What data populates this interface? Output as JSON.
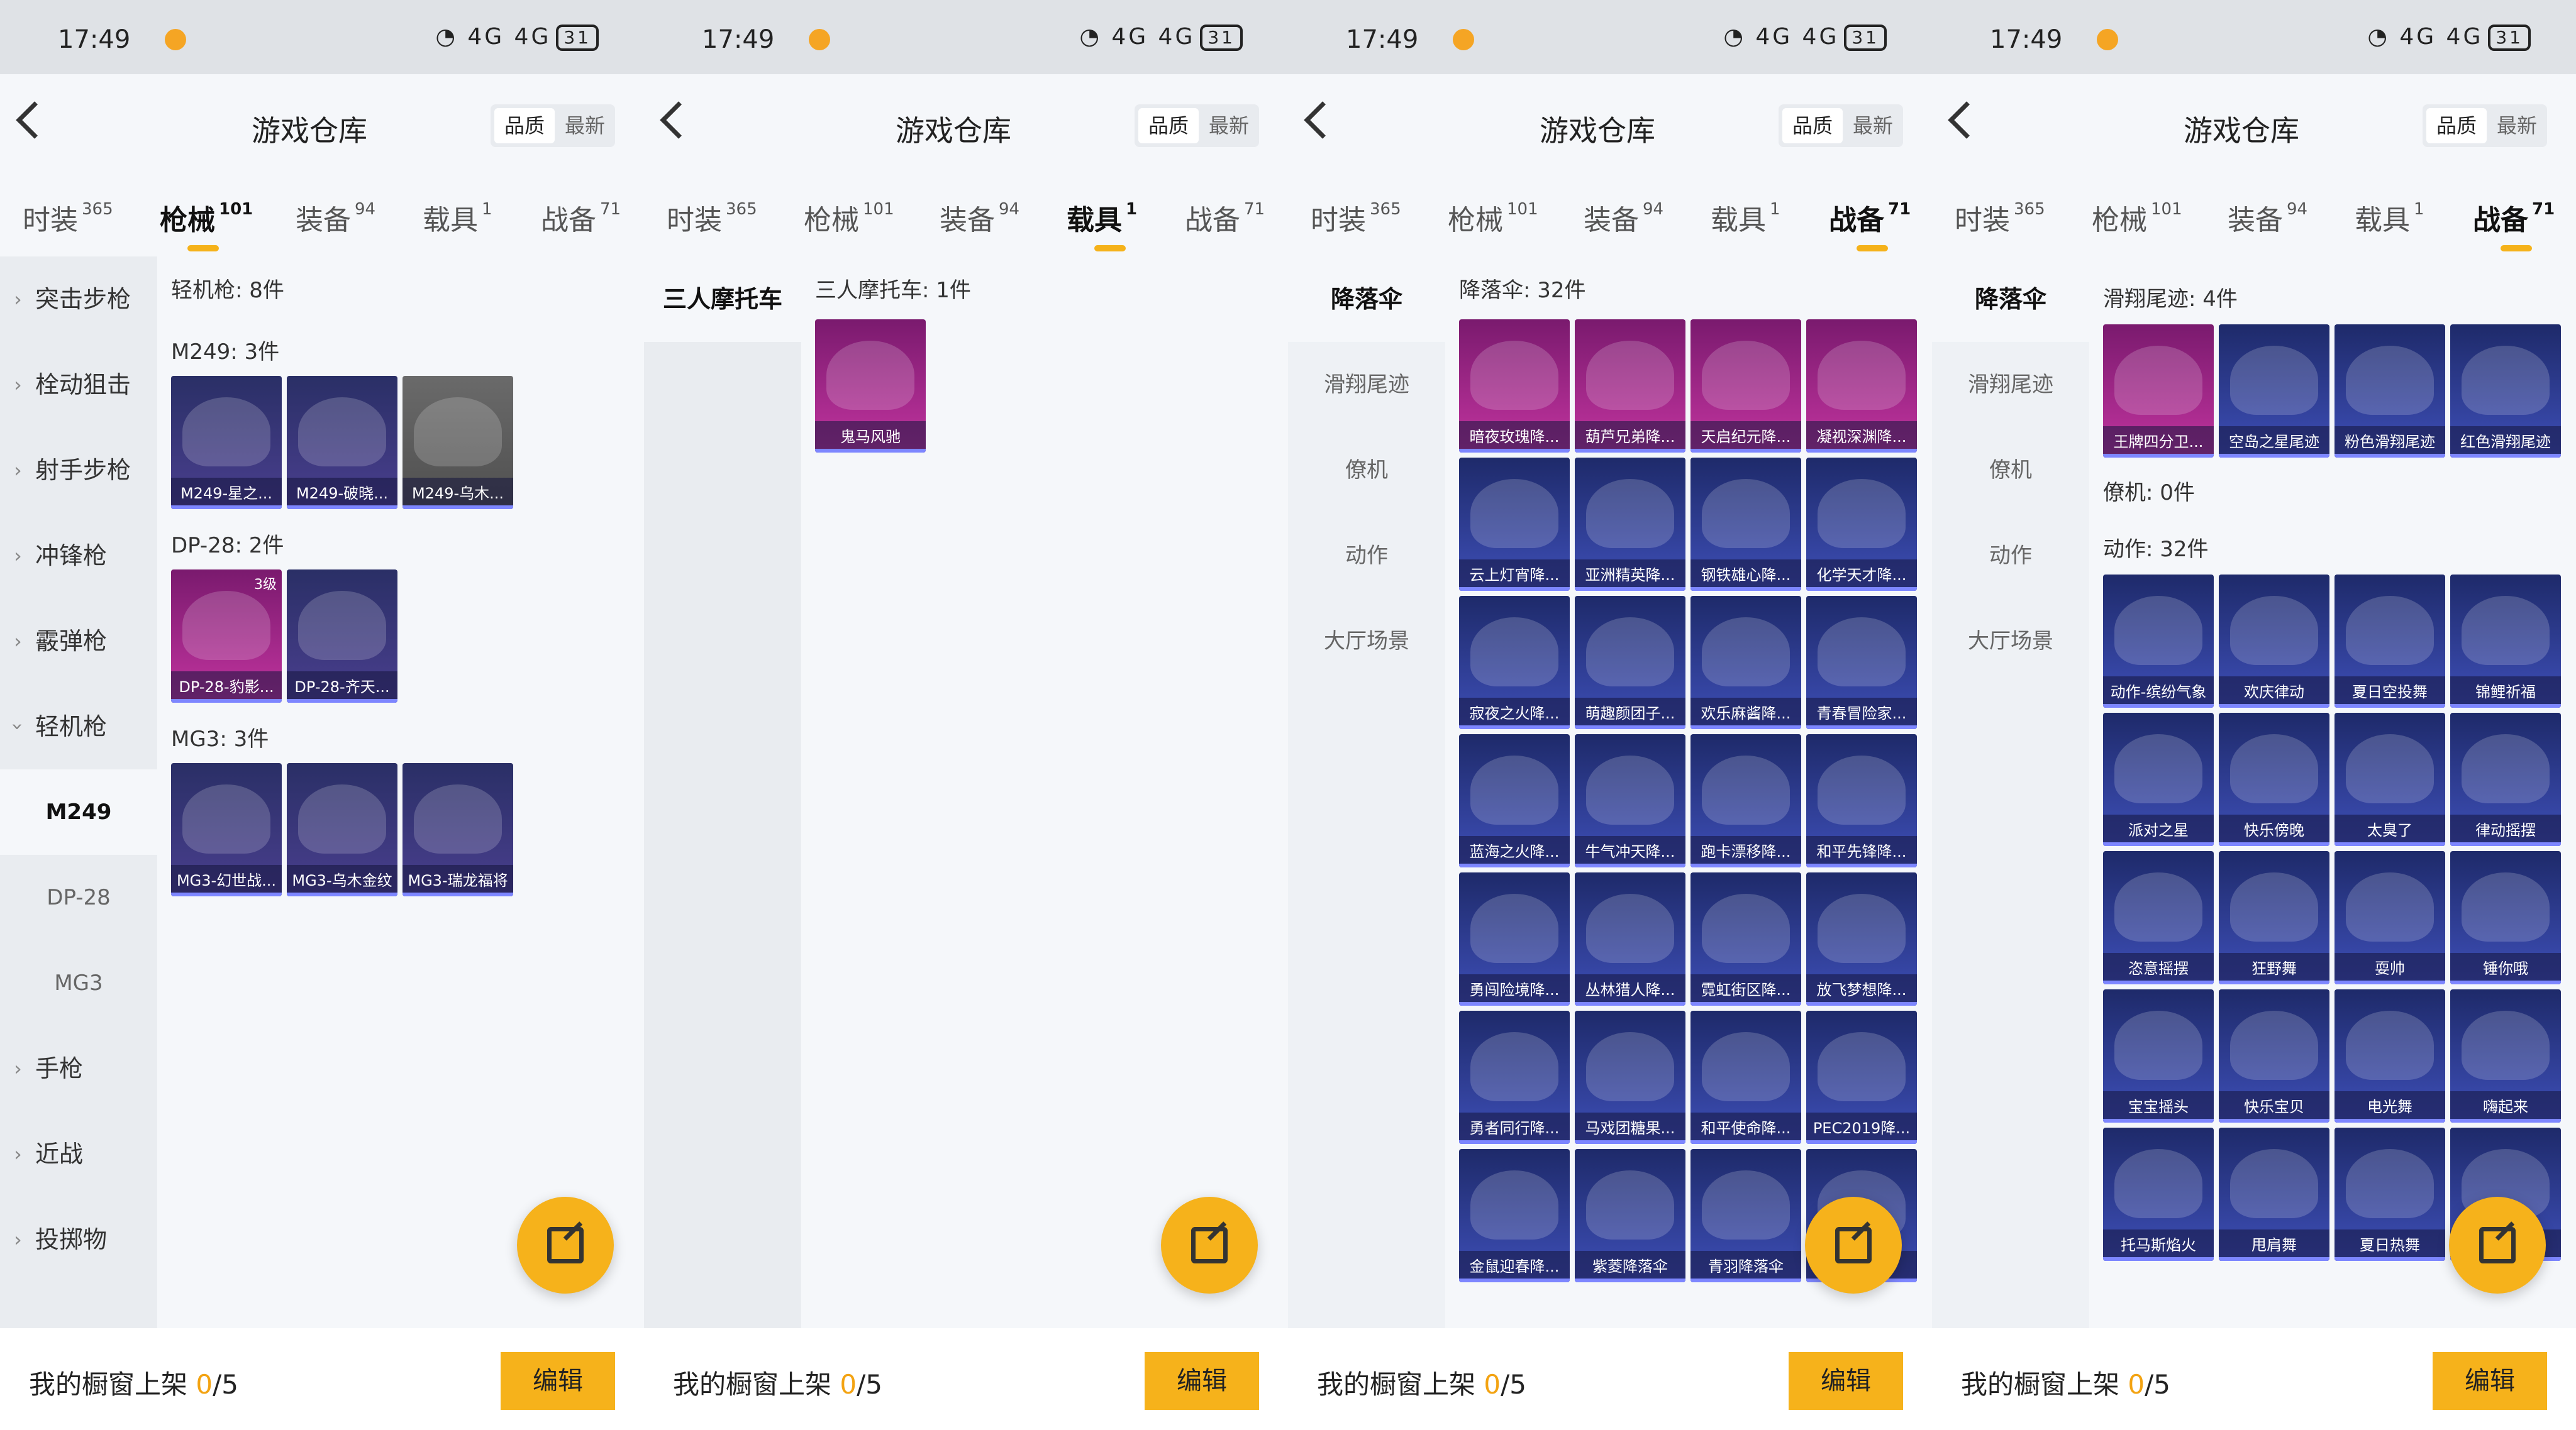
{
  "status": {
    "time": "17:49",
    "network": "4G 4G",
    "battery": "31"
  },
  "header": {
    "title": "游戏仓库",
    "sort_quality": "品质",
    "sort_latest": "最新"
  },
  "tabs": [
    {
      "label": "时装",
      "count": "365"
    },
    {
      "label": "枪械",
      "count": "101"
    },
    {
      "label": "装备",
      "count": "94"
    },
    {
      "label": "载具",
      "count": "1"
    },
    {
      "label": "战备",
      "count": "71"
    }
  ],
  "bottom": {
    "label_prefix": "我的橱窗上架 ",
    "count": "0",
    "total": "/5",
    "edit_label": "编辑"
  },
  "panel1": {
    "sidebar": [
      "突击步枪",
      "栓动狙击",
      "射手步枪",
      "冲锋枪",
      "霰弹枪",
      "轻机枪",
      "M249",
      "DP-28",
      "MG3",
      "手枪",
      "近战",
      "投掷物"
    ],
    "heading": "轻机枪: 8件",
    "sections": [
      {
        "title": "M249: 3件",
        "items": [
          "M249-星之...",
          "M249-破晓...",
          "M249-乌木..."
        ]
      },
      {
        "title": "DP-28: 2件",
        "items": [
          "DP-28-豹影...",
          "DP-28-齐天..."
        ],
        "badge": "3级"
      },
      {
        "title": "MG3: 3件",
        "items": [
          "MG3-幻世战...",
          "MG3-乌木金纹",
          "MG3-瑞龙福将"
        ]
      }
    ]
  },
  "panel2": {
    "sidebar": [
      "三人摩托车"
    ],
    "section": "三人摩托车: 1件",
    "items": [
      "鬼马风驰"
    ]
  },
  "panel3": {
    "sidebar": [
      "降落伞",
      "滑翔尾迹",
      "僚机",
      "动作",
      "大厅场景"
    ],
    "section": "降落伞: 32件",
    "items": [
      "暗夜玫瑰降...",
      "葫芦兄弟降...",
      "天启纪元降...",
      "凝视深渊降...",
      "云上灯宵降...",
      "亚洲精英降...",
      "钢铁雄心降...",
      "化学天才降...",
      "寂夜之火降...",
      "萌趣颜团子...",
      "欢乐麻酱降...",
      "青春冒险家...",
      "蓝海之火降...",
      "牛气冲天降...",
      "跑卡漂移降...",
      "和平先锋降...",
      "勇闯险境降...",
      "丛林猎人降...",
      "霓虹街区降...",
      "放飞梦想降...",
      "勇者同行降...",
      "马戏团糖果...",
      "和平使命降...",
      "PEC2019降...",
      "金鼠迎春降...",
      "紫菱降落伞",
      "青羽降落伞",
      ""
    ]
  },
  "panel4": {
    "sidebar": [
      "降落伞",
      "滑翔尾迹",
      "僚机",
      "动作",
      "大厅场景"
    ],
    "trail_section": "滑翔尾迹: 4件",
    "trails": [
      "王牌四分卫...",
      "空岛之星尾迹",
      "粉色滑翔尾迹",
      "红色滑翔尾迹"
    ],
    "wing_section": "僚机: 0件",
    "action_section": "动作: 32件",
    "actions": [
      "动作-缤纷气象",
      "欢庆律动",
      "夏日空投舞",
      "锦鲤祈福",
      "派对之星",
      "快乐傍晚",
      "太臭了",
      "律动摇摆",
      "恣意摇摆",
      "狂野舞",
      "耍帅",
      "锤你哦",
      "宝宝摇头",
      "快乐宝贝",
      "电光舞",
      "嗨起来",
      "托马斯焰火",
      "甩肩舞",
      "夏日热舞",
      ""
    ]
  }
}
